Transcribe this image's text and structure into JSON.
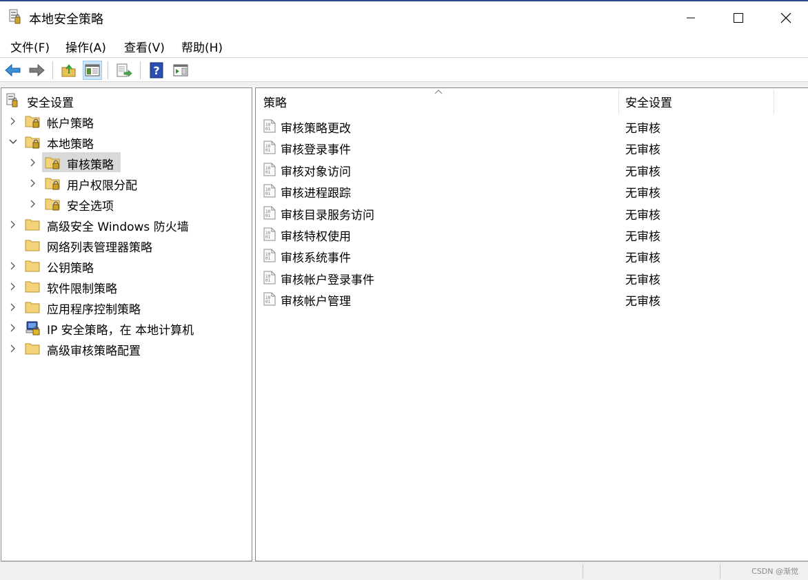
{
  "window": {
    "title": "本地安全策略",
    "app_icon": "security-policy-icon",
    "controls": [
      "minimize-icon",
      "maximize-icon",
      "close-icon"
    ]
  },
  "menu": {
    "items": [
      "文件(F)",
      "操作(A)",
      "查看(V)",
      "帮助(H)"
    ]
  },
  "toolbar": {
    "buttons": [
      "back-arrow-icon",
      "forward-arrow-icon",
      "up-folder-icon",
      "show-hide-tree-icon",
      "export-list-icon",
      "help-icon",
      "show-action-pane-icon"
    ]
  },
  "tree": {
    "root": "安全设置",
    "nodes": [
      {
        "label": "帐户策略",
        "icon": "locked-folder-icon"
      },
      {
        "label": "本地策略",
        "icon": "locked-folder-icon"
      },
      {
        "label": "审核策略",
        "icon": "locked-folder-icon"
      },
      {
        "label": "用户权限分配",
        "icon": "locked-folder-icon"
      },
      {
        "label": "安全选项",
        "icon": "locked-folder-icon"
      },
      {
        "label": "高级安全 Windows 防火墙",
        "icon": "folder-icon"
      },
      {
        "label": "网络列表管理器策略",
        "icon": "folder-icon"
      },
      {
        "label": "公钥策略",
        "icon": "folder-icon"
      },
      {
        "label": "软件限制策略",
        "icon": "folder-icon"
      },
      {
        "label": "应用程序控制策略",
        "icon": "folder-icon"
      },
      {
        "label": "IP 安全策略，在 本地计算机",
        "icon": "ip-security-icon"
      },
      {
        "label": "高级审核策略配置",
        "icon": "folder-icon"
      }
    ]
  },
  "list": {
    "columns": [
      "策略",
      "安全设置"
    ],
    "rows": [
      {
        "policy": "审核策略更改",
        "setting": "无审核"
      },
      {
        "policy": "审核登录事件",
        "setting": "无审核"
      },
      {
        "policy": "审核对象访问",
        "setting": "无审核"
      },
      {
        "policy": "审核进程跟踪",
        "setting": "无审核"
      },
      {
        "policy": "审核目录服务访问",
        "setting": "无审核"
      },
      {
        "policy": "审核特权使用",
        "setting": "无审核"
      },
      {
        "policy": "审核系统事件",
        "setting": "无审核"
      },
      {
        "policy": "审核帐户登录事件",
        "setting": "无审核"
      },
      {
        "policy": "审核帐户管理",
        "setting": "无审核"
      }
    ]
  },
  "status": {
    "watermark": "CSDN @渐觉"
  }
}
